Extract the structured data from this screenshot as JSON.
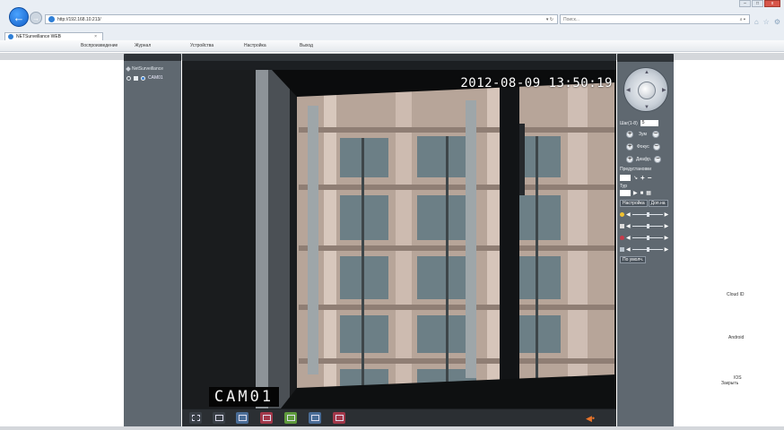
{
  "browser": {
    "url": "http://192.168.10.213/",
    "search_placeholder": "Поиск...",
    "tab_title": "NETSurveillance WEB",
    "tab_close": "×",
    "refresh_glyph": "▾ ↻",
    "search_glyph": "⌕ ▾"
  },
  "menu": {
    "items": [
      "Воспроизведение",
      "Журнал",
      "Устройства",
      "Настройка",
      "Выход"
    ]
  },
  "device_tree": {
    "root_label": "NetSurveillance",
    "camera_label": "CAM01"
  },
  "video": {
    "timestamp": "2012-08-09 13:50:19",
    "camera_overlay": "CAM01"
  },
  "toolbar": {
    "buttons": [
      "fullscreen-icon",
      "window-icon",
      "record-icon",
      "snapshot-icon",
      "layout-icon",
      "talk-icon",
      "playback-icon"
    ],
    "audio_icon": "speaker-icon"
  },
  "ptz": {
    "step_label": "Шаг(1-8)",
    "step_value": "5",
    "zoom_label": "Зум",
    "focus_label": "Фокус",
    "iris_label": "Диафр.",
    "preset_label": "Предустановки",
    "tour_label": "Тур",
    "tabs": [
      "Настройка",
      "Доп.на"
    ],
    "default_button": "По умолч."
  },
  "side_links": {
    "cloud_id": "Cloud ID",
    "android": "Android",
    "ios": "IOS",
    "close": "Закрыть"
  },
  "colors": {
    "panel": "#5f6870",
    "header": "#2e3338",
    "accent": "#2f7fd6"
  }
}
